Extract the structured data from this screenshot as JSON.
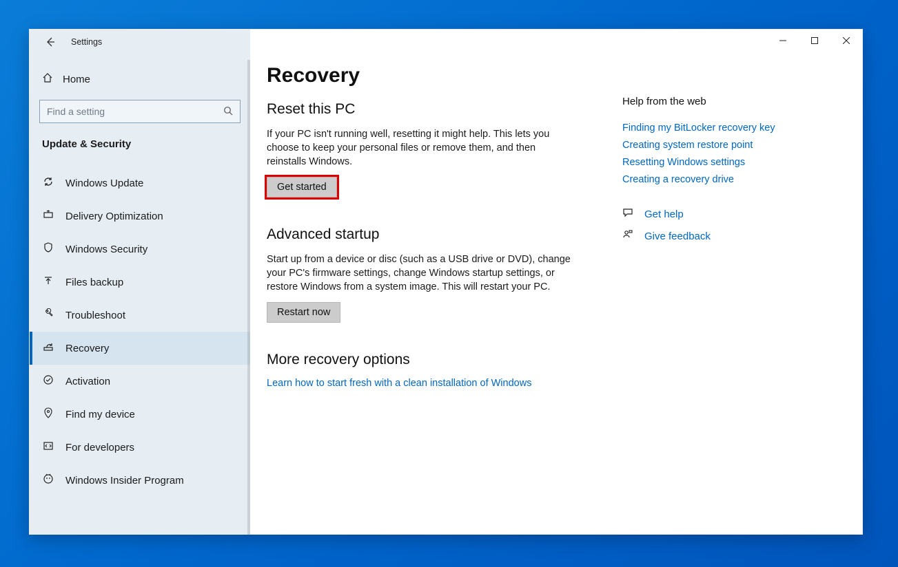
{
  "app_title": "Settings",
  "sidebar": {
    "home_label": "Home",
    "search_placeholder": "Find a setting",
    "section_label": "Update & Security",
    "items": [
      {
        "label": "Windows Update"
      },
      {
        "label": "Delivery Optimization"
      },
      {
        "label": "Windows Security"
      },
      {
        "label": "Files backup"
      },
      {
        "label": "Troubleshoot"
      },
      {
        "label": "Recovery"
      },
      {
        "label": "Activation"
      },
      {
        "label": "Find my device"
      },
      {
        "label": "For developers"
      },
      {
        "label": "Windows Insider Program"
      }
    ],
    "selected_index": 5
  },
  "page": {
    "title": "Recovery",
    "reset": {
      "heading": "Reset this PC",
      "description": "If your PC isn't running well, resetting it might help. This lets you choose to keep your personal files or remove them, and then reinstalls Windows.",
      "button": "Get started"
    },
    "advanced": {
      "heading": "Advanced startup",
      "description": "Start up from a device or disc (such as a USB drive or DVD), change your PC's firmware settings, change Windows startup settings, or restore Windows from a system image. This will restart your PC.",
      "button": "Restart now"
    },
    "more": {
      "heading": "More recovery options",
      "link": "Learn how to start fresh with a clean installation of Windows"
    }
  },
  "help": {
    "heading": "Help from the web",
    "links": [
      "Finding my BitLocker recovery key",
      "Creating system restore point",
      "Resetting Windows settings",
      "Creating a recovery drive"
    ],
    "get_help": "Get help",
    "give_feedback": "Give feedback"
  }
}
